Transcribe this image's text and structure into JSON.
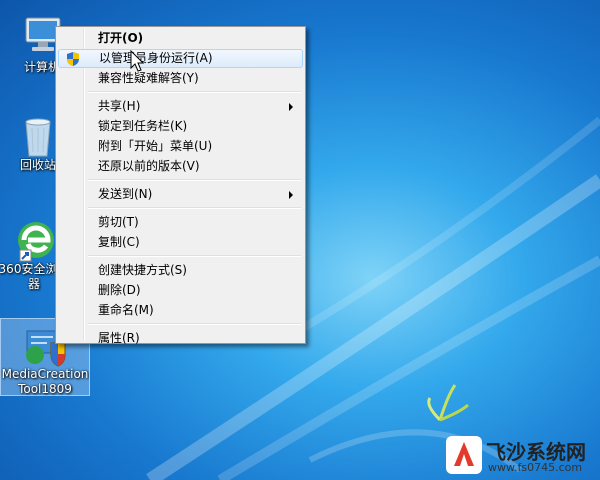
{
  "desktop": {
    "icons": [
      {
        "label": "计算机"
      },
      {
        "label": "回收站"
      },
      {
        "label": "360安全浏览器"
      },
      {
        "label": "MediaCreationTool1809"
      }
    ]
  },
  "context_menu": {
    "items": [
      {
        "label": "打开(O)"
      },
      {
        "label": "以管理员身份运行(A)"
      },
      {
        "label": "兼容性疑难解答(Y)"
      },
      {
        "label": "共享(H)"
      },
      {
        "label": "锁定到任务栏(K)"
      },
      {
        "label": "附到「开始」菜单(U)"
      },
      {
        "label": "还原以前的版本(V)"
      },
      {
        "label": "发送到(N)"
      },
      {
        "label": "剪切(T)"
      },
      {
        "label": "复制(C)"
      },
      {
        "label": "创建快捷方式(S)"
      },
      {
        "label": "删除(D)"
      },
      {
        "label": "重命名(M)"
      },
      {
        "label": "属性(R)"
      }
    ]
  },
  "watermark": {
    "title": "飞沙系统网",
    "url": "www.fs0745.com"
  },
  "colors": {
    "desktop_bg": "#1878cf",
    "menu_bg": "#f0f0f0",
    "hover_border": "#a8d8fb"
  }
}
